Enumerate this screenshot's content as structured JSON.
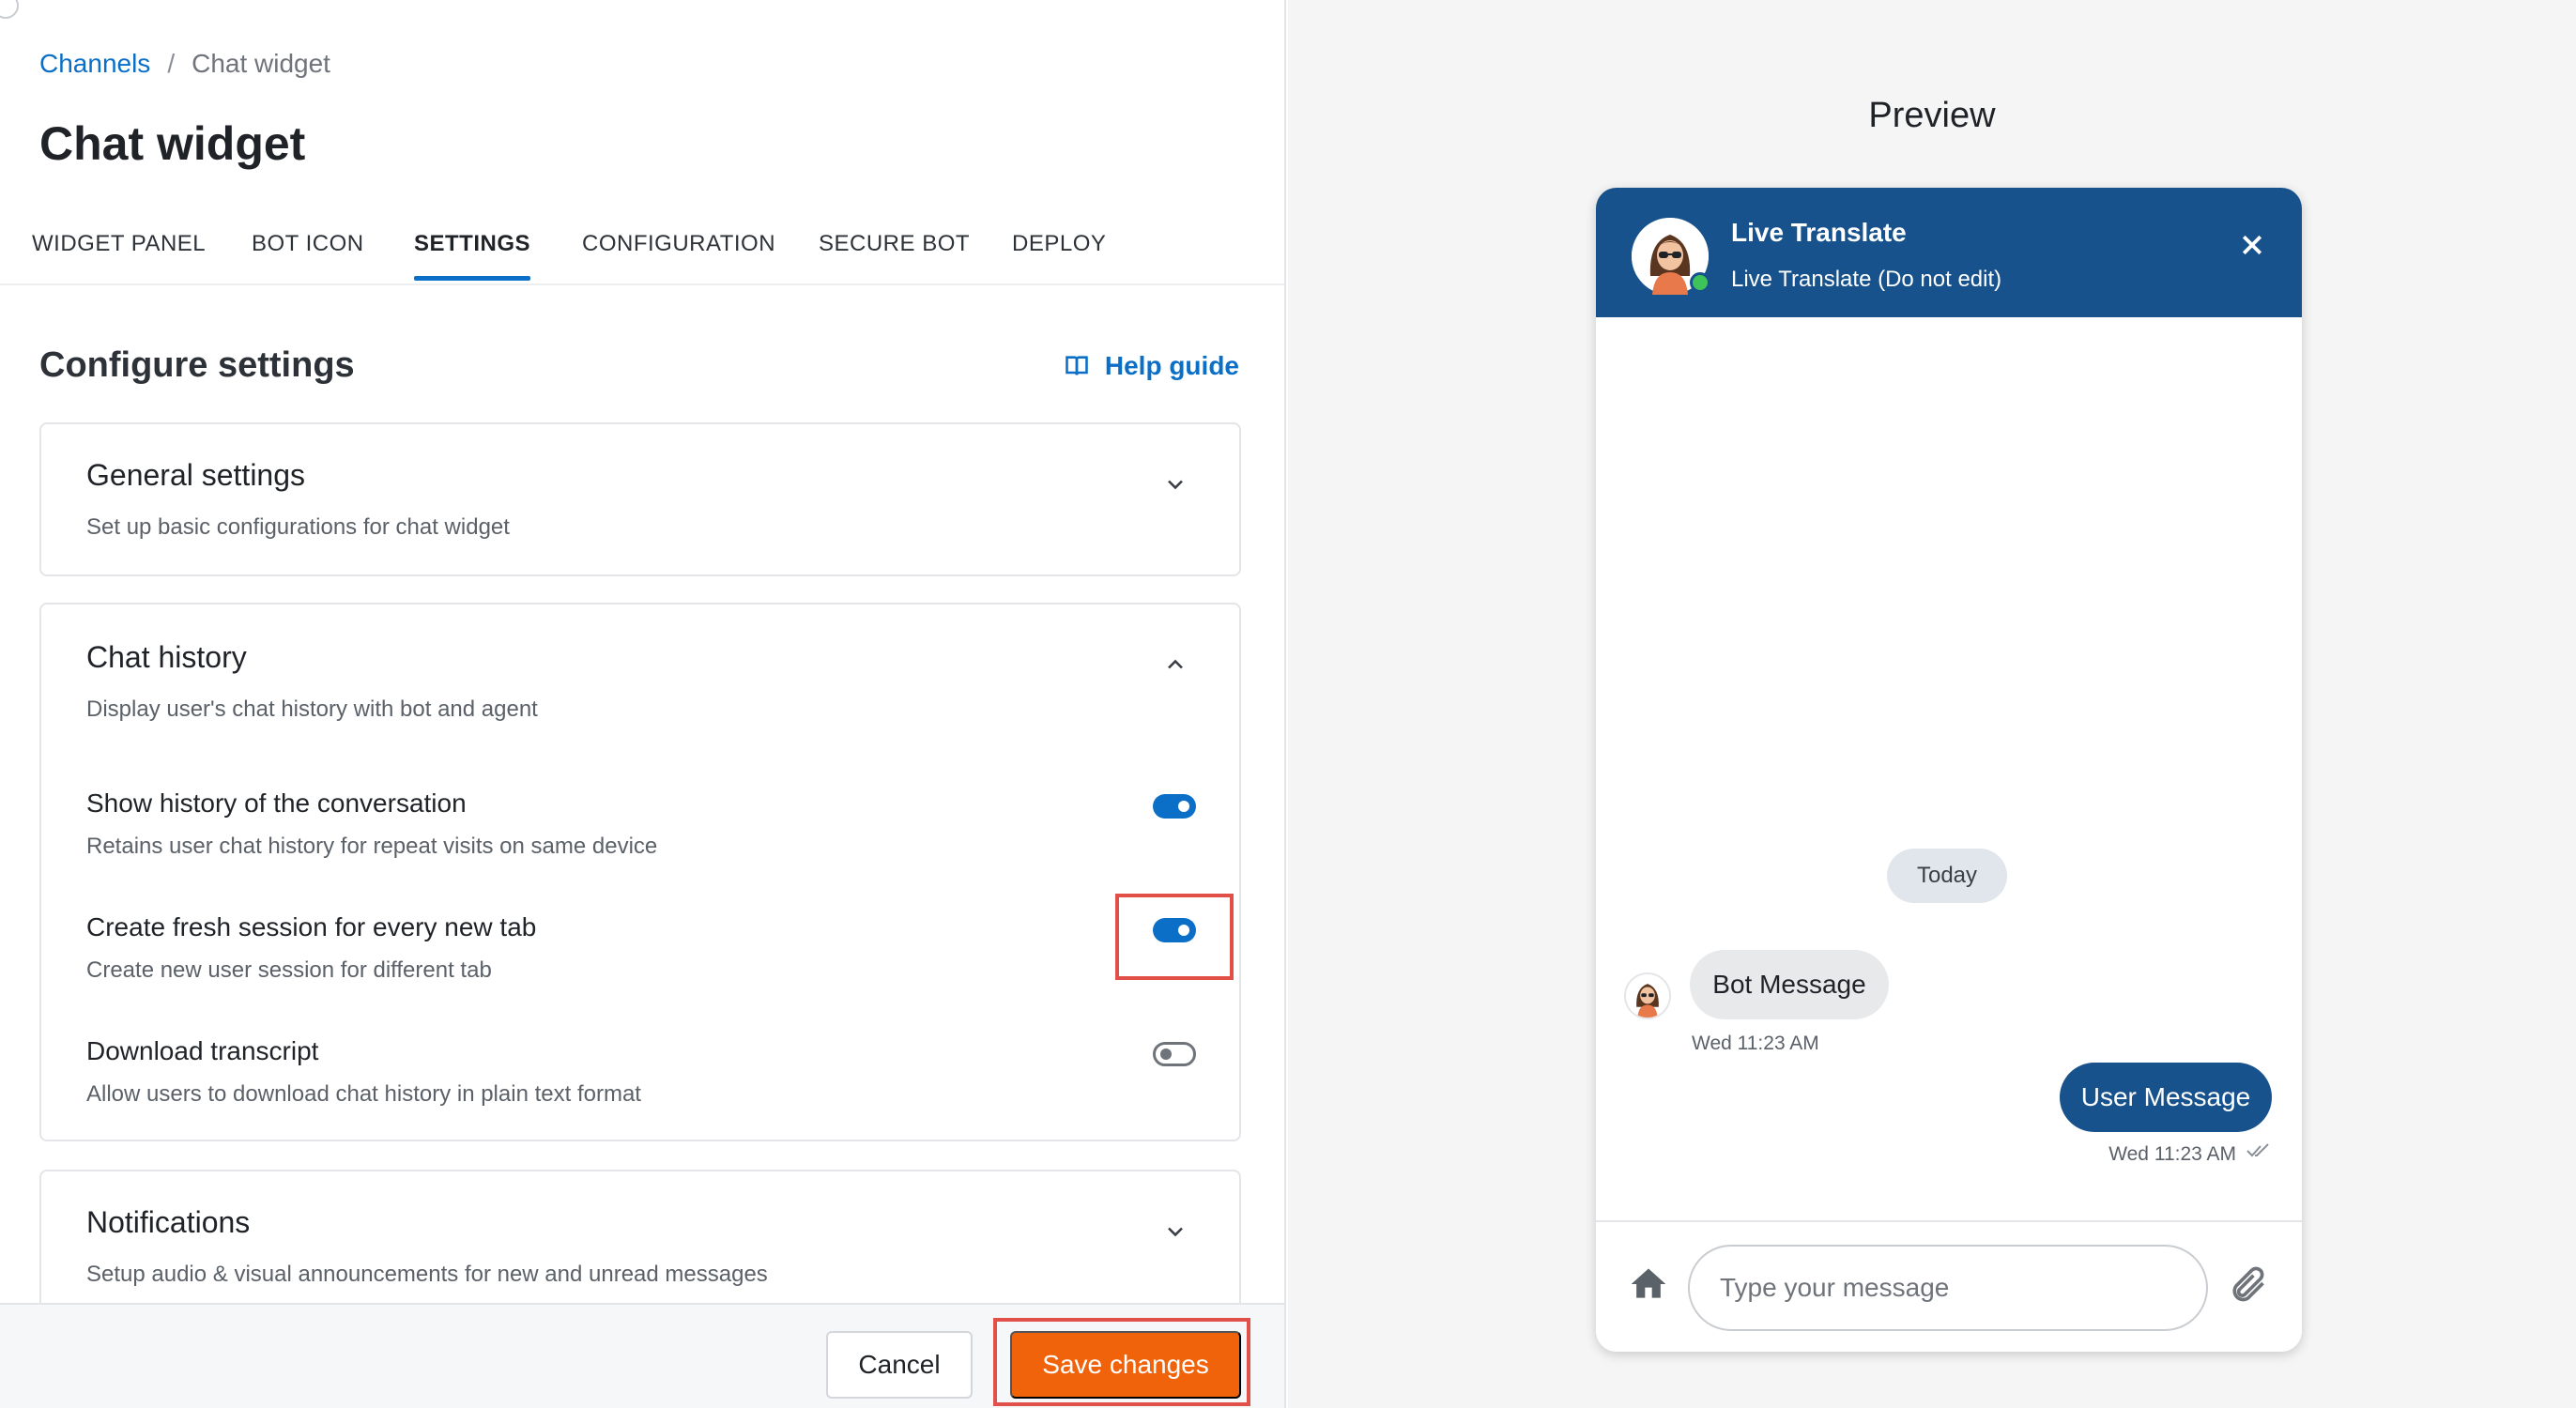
{
  "breadcrumb": {
    "parent": "Channels",
    "separator": "/",
    "current": "Chat widget"
  },
  "page": {
    "title": "Chat widget"
  },
  "tabs": [
    {
      "label": "WIDGET PANEL"
    },
    {
      "label": "BOT ICON"
    },
    {
      "label": "SETTINGS",
      "active": true
    },
    {
      "label": "CONFIGURATION"
    },
    {
      "label": "SECURE BOT"
    },
    {
      "label": "DEPLOY"
    }
  ],
  "settings": {
    "title": "Configure settings",
    "help_label": "Help guide",
    "sections": {
      "general": {
        "title": "General settings",
        "subtitle": "Set up basic configurations for chat widget",
        "expanded": false
      },
      "chat_history": {
        "title": "Chat history",
        "subtitle": "Display user's chat history with bot and agent",
        "expanded": true,
        "items": [
          {
            "title": "Show history of the conversation",
            "subtitle": "Retains user chat history for repeat visits on same device",
            "enabled": true
          },
          {
            "title": "Create fresh session for every new tab",
            "subtitle": "Create new user session for different tab",
            "enabled": true
          },
          {
            "title": "Download transcript",
            "subtitle": "Allow users to download chat history in plain text format",
            "enabled": false
          }
        ]
      },
      "notifications": {
        "title": "Notifications",
        "subtitle": "Setup audio & visual announcements for new and unread messages",
        "expanded": false
      }
    }
  },
  "footer": {
    "cancel_label": "Cancel",
    "save_label": "Save changes"
  },
  "preview": {
    "title": "Preview",
    "bot_name": "Live Translate",
    "bot_subtitle": "Live Translate (Do not edit)",
    "date_pill": "Today",
    "bot_message": "Bot Message",
    "bot_time": "Wed 11:23 AM",
    "user_message": "User Message",
    "user_time": "Wed 11:23 AM",
    "input_placeholder": "Type your message"
  },
  "colors": {
    "accent": "#0b6fc7",
    "save_button": "#f0630a",
    "highlight": "#e2504a",
    "widget_header": "#17528c",
    "online": "#3ec35a"
  }
}
